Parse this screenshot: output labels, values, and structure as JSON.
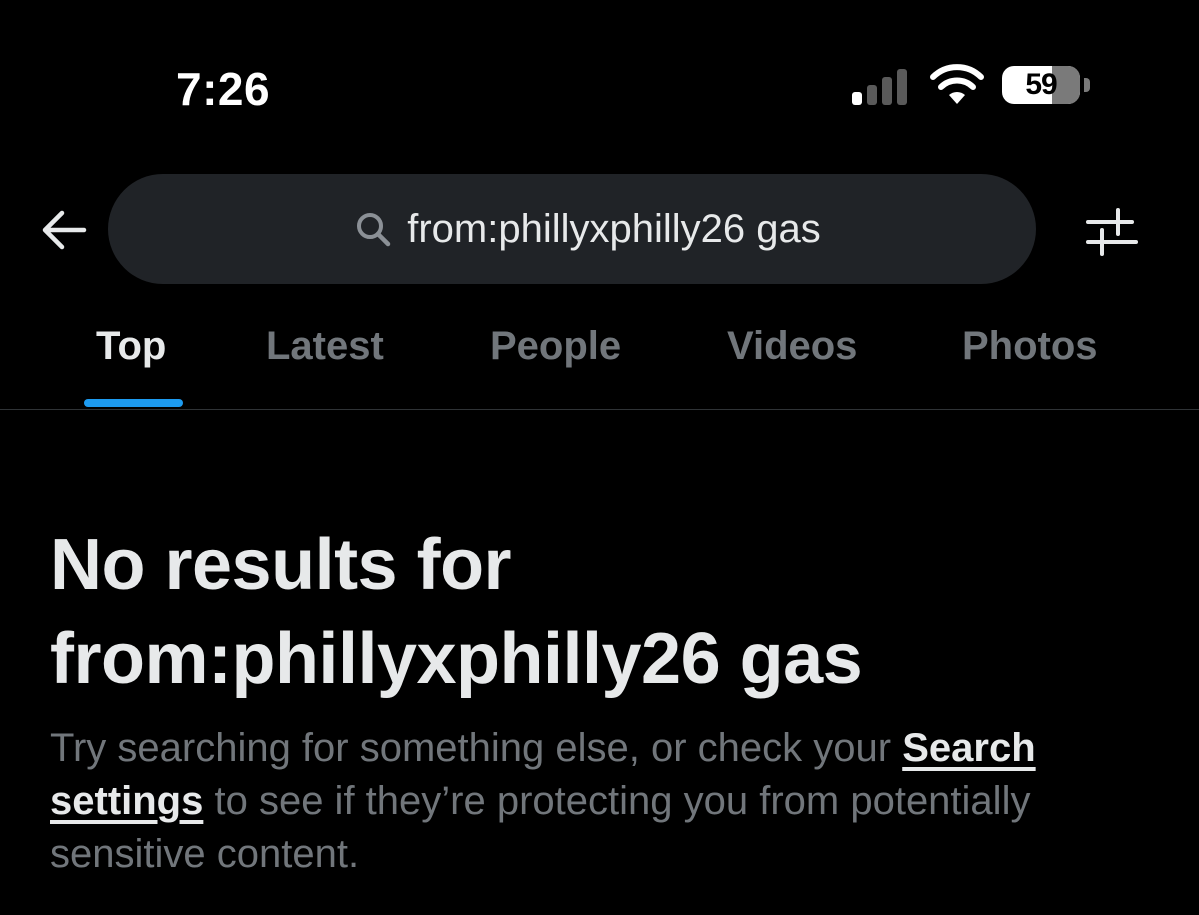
{
  "status_bar": {
    "time": "7:26",
    "battery_level": "59",
    "icons": [
      "signal-bars-icon",
      "wifi-icon",
      "battery-icon"
    ]
  },
  "search": {
    "query": "from:phillyxphilly26 gas",
    "icons": [
      "back-arrow-icon",
      "search-icon",
      "filter-sliders-icon"
    ]
  },
  "tabs": [
    {
      "label": "Top",
      "active": true
    },
    {
      "label": "Latest",
      "active": false
    },
    {
      "label": "People",
      "active": false
    },
    {
      "label": "Videos",
      "active": false
    },
    {
      "label": "Photos",
      "active": false
    }
  ],
  "empty_state": {
    "title_prefix": "No results for",
    "title_query": "from:phillyxphilly26 gas",
    "body_before_link": "Try searching for something else, or check your ",
    "link_label": "Search settings",
    "body_after_link": " to see if they’re protecting you from potentially sensitive content."
  },
  "colors": {
    "background": "#000000",
    "text_primary": "#e7e9ea",
    "text_secondary": "#71767b",
    "accent": "#1d9bf0",
    "search_pill": "#202327"
  }
}
